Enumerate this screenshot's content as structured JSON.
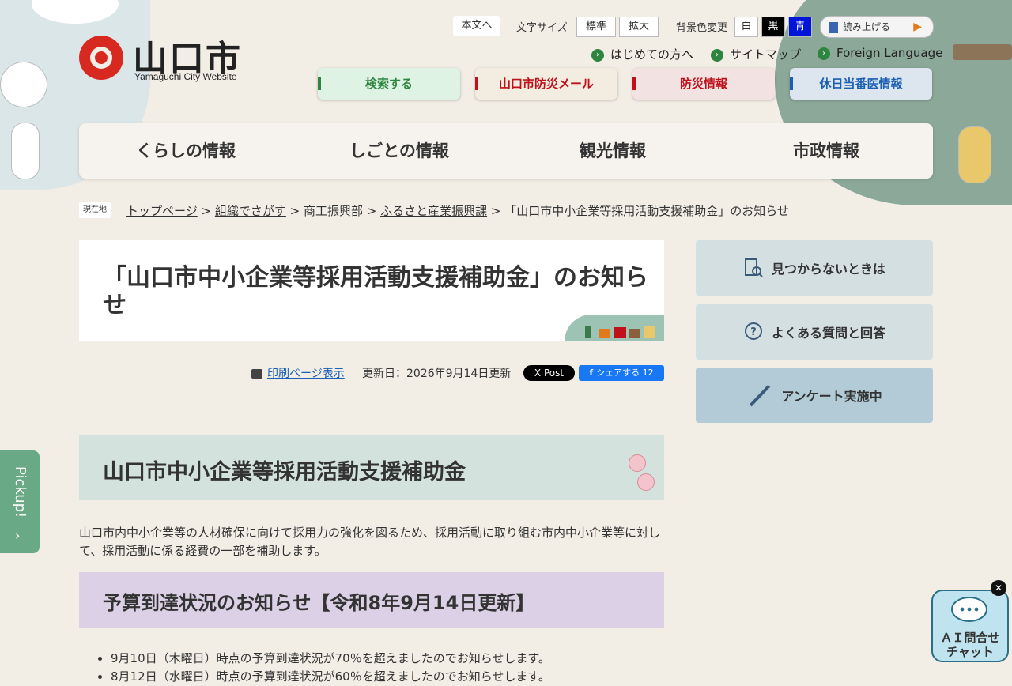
{
  "header": {
    "logo_text": "山口市",
    "logo_sub": "Yamaguchi City Website",
    "skip_link": "本文へ",
    "font_size_label": "文字サイズ",
    "font_size_options": [
      "標準",
      "拡大"
    ],
    "bg_color_label": "背景色変更",
    "bg_color_options": [
      "白",
      "黒",
      "青"
    ],
    "read_aloud": "読み上げる",
    "sub_links": [
      "はじめての方へ",
      "サイトマップ",
      "Foreign Language"
    ],
    "quick_links": [
      "検索する",
      "山口市防災メール",
      "防災情報",
      "休日当番医情報"
    ]
  },
  "main_nav": [
    "くらしの情報",
    "しごとの情報",
    "観光情報",
    "市政情報"
  ],
  "breadcrumb": {
    "tag": "現在地",
    "items": [
      "トップページ",
      "組織でさがす",
      "商工振興部",
      "ふるさと産業振興課",
      "「山口市中小企業等採用活動支援補助金」のお知らせ"
    ]
  },
  "page": {
    "title": "「山口市中小企業等採用活動支援補助金」のお知らせ",
    "print_link": "印刷ページ表示",
    "updated": "更新日：2026年9月14日更新",
    "x_post": "X Post",
    "fb_share": "シェアする 12"
  },
  "sidebar": {
    "buttons": [
      "見つからないときは",
      "よくある質問と回答",
      "アンケート実施中"
    ]
  },
  "content": {
    "heading": "山口市中小企業等採用活動支援補助金",
    "intro": "山口市内中小企業等の人材確保に向けて採用力の強化を図るため、採用活動に取り組む市内中小企業等に対して、採用活動に係る経費の一部を補助します。",
    "subheading": "予算到達状況のお知らせ【令和8年9月14日更新】",
    "bullets": [
      "9月10日（木曜日）時点の予算到達状況が70％を超えましたのでお知らせします。",
      "8月12日（水曜日）時点の予算到達状況が60％を超えましたのでお知らせします。"
    ]
  },
  "floating": {
    "pickup": "Pickup!",
    "ai_chat_line1": "ＡＩ問合せ",
    "ai_chat_line2": "チャット"
  },
  "colors": {
    "green": "#2e8540",
    "red": "#d7291f",
    "blue_link": "#1a5fb4"
  }
}
